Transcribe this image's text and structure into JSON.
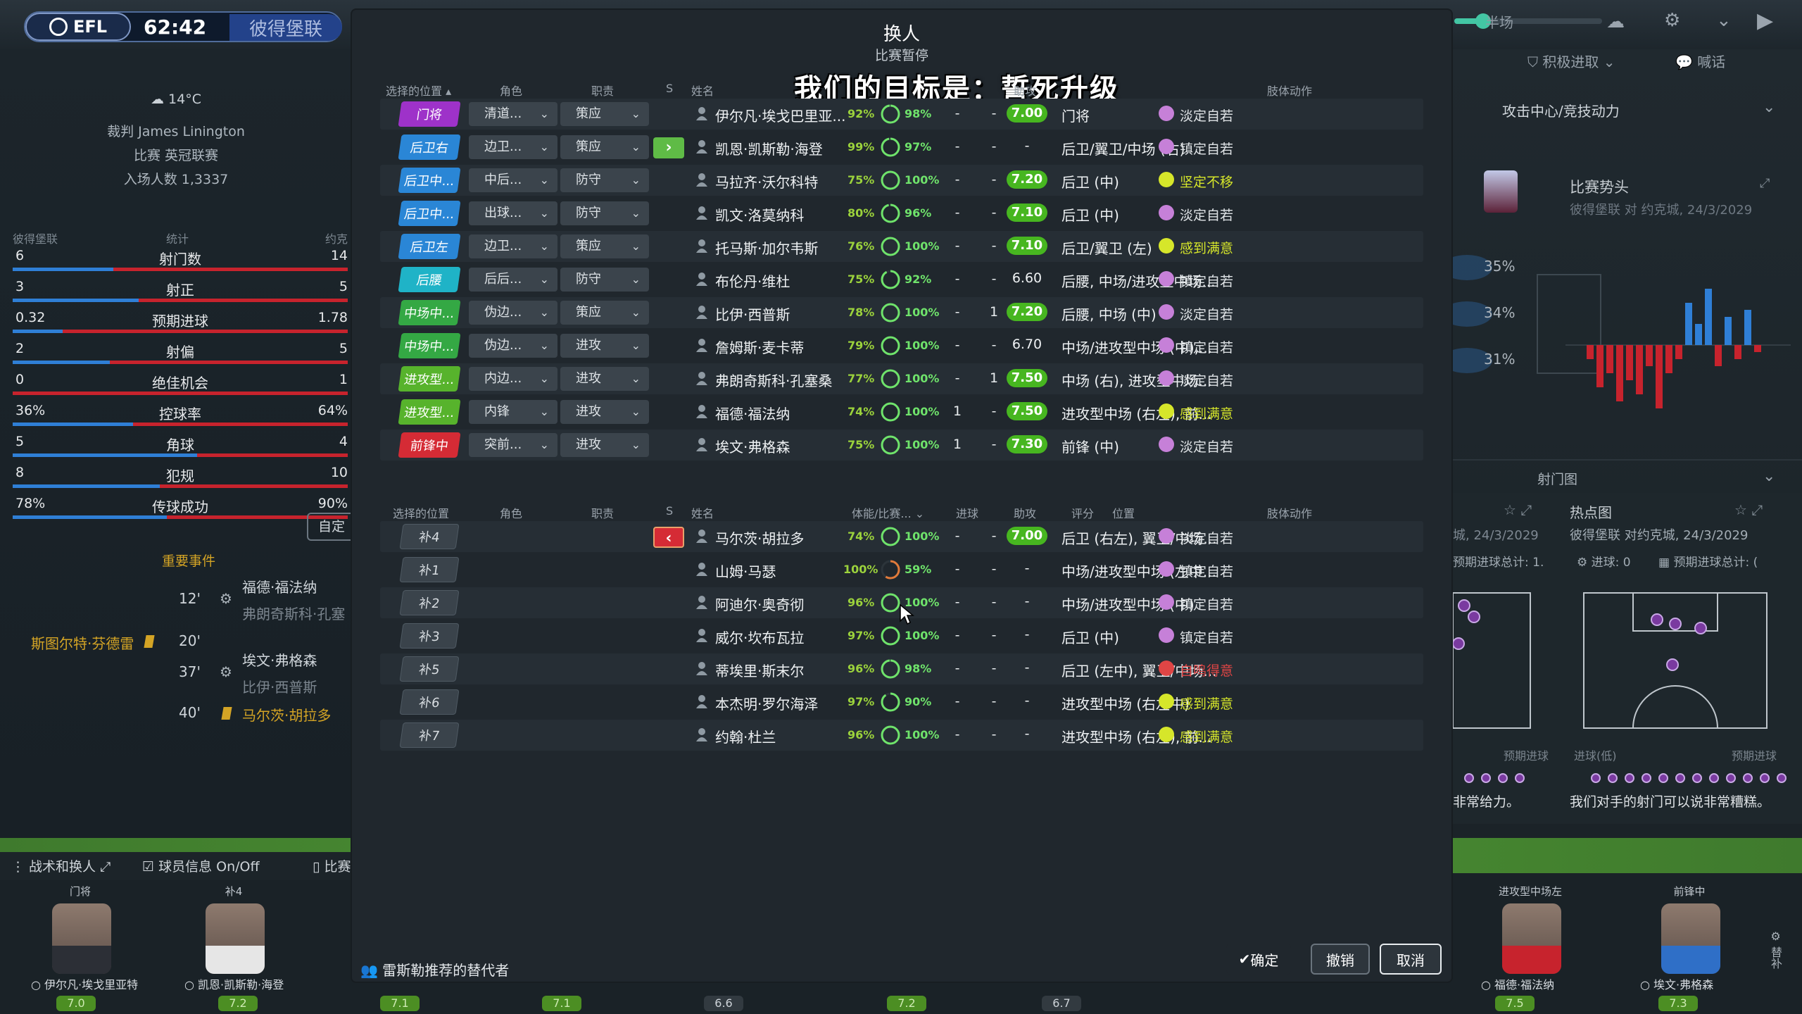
{
  "top": {
    "competition_logo": "EFL",
    "clock": "62:42",
    "team": "彼得堡联",
    "speed_label": "半场"
  },
  "match_info": {
    "weather": "14°C",
    "referee": "裁判 James Linington",
    "competition": "比赛 英冠联赛",
    "attendance": "入场人数 1,3337"
  },
  "stats": {
    "home": "彼得堡联",
    "header": "统计",
    "away": "约克",
    "rows": [
      {
        "label": "射门数",
        "home": "6",
        "away": "14",
        "home_share": 0.3
      },
      {
        "label": "射正",
        "home": "3",
        "away": "5",
        "home_share": 0.375
      },
      {
        "label": "预期进球",
        "home": "0.32",
        "away": "1.78",
        "home_share": 0.15
      },
      {
        "label": "射偏",
        "home": "2",
        "away": "5",
        "home_share": 0.29
      },
      {
        "label": "绝佳机会",
        "home": "0",
        "away": "1",
        "home_share": 0.0
      },
      {
        "label": "控球率",
        "home": "36%",
        "away": "64%",
        "home_share": 0.36
      },
      {
        "label": "角球",
        "home": "5",
        "away": "4",
        "home_share": 0.55
      },
      {
        "label": "犯规",
        "home": "8",
        "away": "10",
        "home_share": 0.44
      },
      {
        "label": "传球成功",
        "home": "78%",
        "away": "90%",
        "home_share": 0.46
      }
    ],
    "customize_button": "自定"
  },
  "events": {
    "header": "重要事件",
    "items": [
      {
        "minute": "12'",
        "player": "福德·福法纳",
        "sub": "弗朗奇斯科·孔塞",
        "type": "substitution"
      },
      {
        "minute": "20'",
        "player": "斯图尔特·芬德雷",
        "type": "yellow-card-away"
      },
      {
        "minute": "37'",
        "player": "埃文·弗格森",
        "sub": "比伊·西普斯",
        "type": "substitution"
      },
      {
        "minute": "40'",
        "player": "马尔茨·胡拉多",
        "type": "yellow-card"
      }
    ]
  },
  "bottom": {
    "tabs": [
      "战术和换人",
      "球员信息 On/Off",
      "比赛"
    ],
    "cards": [
      {
        "pos": "门将",
        "name": "伊尔凡·埃戈里亚特"
      },
      {
        "pos": "补4",
        "name": "凯恩·凯斯勒·海登"
      },
      {
        "pos": "进攻型中场左",
        "name": "福德·福法纳"
      },
      {
        "pos": "前锋中",
        "name": "埃文·弗格森"
      }
    ],
    "ratings": [
      "7.0",
      "7.2",
      "7.1",
      "7.1",
      "6.6",
      "7.2",
      "6.7",
      "7.5",
      "7.3"
    ]
  },
  "right_panel": {
    "dropdown1": "积极进取",
    "dropdown2": "喊话",
    "focus": "攻击中心/竞技动力",
    "momentum_title": "比赛势头",
    "momentum_sub": "彼得堡联 对 约克城, 24/3/2029",
    "percents": [
      "35%",
      "34%",
      "31%"
    ],
    "shotmap_title": "射门图",
    "shotmap_date": "城, 24/3/2029",
    "xg_label": "预期进球总计: 1.",
    "heatmap_title": "热点图",
    "heatmap_sub": "彼得堡联 对约克城, 24/3/2029",
    "goals_label": "进球: 0",
    "xg_label2": "预期进球总计: (",
    "legend_left": "预期进球",
    "legend_mid": "进球(低)",
    "legend_right": "预期进球",
    "caption_left": "非常给力。",
    "caption_right": "我们对手的射门可以说非常糟糕。"
  },
  "dialog": {
    "title": "换人",
    "subtitle": "比赛暂停",
    "overlay": "我们的目标是：誓死升级",
    "headers": {
      "position": "选择的位置",
      "role": "角色",
      "duty": "职责",
      "s": "S",
      "name": "姓名",
      "assist": "助攻",
      "behaviour": "肢体动作"
    },
    "headers2": {
      "position": "选择的位置",
      "role": "角色",
      "duty": "职责",
      "s": "S",
      "name": "姓名",
      "condition": "体能/比赛...",
      "goals": "进球",
      "assists": "助攻",
      "rating": "评分",
      "pos": "位置",
      "behaviour": "肢体动作"
    },
    "starters": [
      {
        "pos": "门将",
        "color": "#9e32c9",
        "role": "清道...",
        "duty": "策应",
        "swap": "",
        "name": "伊尔凡·埃戈巴里亚...",
        "fit": "92%",
        "sharp": "98%",
        "sharpness": 0.98,
        "goals": "-",
        "assists": "-",
        "rating": "7.00",
        "positions": "门将",
        "behaviour": "淡定自若",
        "mood": "neutral"
      },
      {
        "pos": "后卫右",
        "color": "#2a86d6",
        "role": "边卫...",
        "duty": "策应",
        "swap": "in",
        "name": "凯恩·凯斯勒·海登",
        "fit": "99%",
        "sharp": "97%",
        "sharpness": 0.97,
        "goals": "-",
        "assists": "-",
        "rating": "-",
        "positions": "后卫/翼卫/中场 (右)",
        "behaviour": "镇定自若",
        "mood": "neutral"
      },
      {
        "pos": "后卫中...",
        "color": "#2a86d6",
        "role": "中后...",
        "duty": "防守",
        "swap": "",
        "name": "马拉齐·沃尔科特",
        "fit": "75%",
        "sharp": "100%",
        "sharpness": 1.0,
        "goals": "-",
        "assists": "-",
        "rating": "7.20",
        "positions": "后卫 (中)",
        "behaviour": "坚定不移",
        "mood": "happy"
      },
      {
        "pos": "后卫中...",
        "color": "#2a86d6",
        "role": "出球...",
        "duty": "防守",
        "swap": "",
        "name": "凯文·洛莫纳科",
        "fit": "80%",
        "sharp": "96%",
        "sharpness": 0.96,
        "goals": "-",
        "assists": "-",
        "rating": "7.10",
        "positions": "后卫 (中)",
        "behaviour": "淡定自若",
        "mood": "neutral"
      },
      {
        "pos": "后卫左",
        "color": "#2a86d6",
        "role": "边卫...",
        "duty": "策应",
        "swap": "",
        "name": "托马斯·加尔韦斯",
        "fit": "76%",
        "sharp": "100%",
        "sharpness": 1.0,
        "goals": "-",
        "assists": "-",
        "rating": "7.10",
        "positions": "后卫/翼卫 (左)",
        "behaviour": "感到满意",
        "mood": "happy"
      },
      {
        "pos": "后腰",
        "color": "#1fb3c7",
        "role": "后后...",
        "duty": "防守",
        "swap": "",
        "name": "布伦丹·维杜",
        "fit": "75%",
        "sharp": "92%",
        "sharpness": 0.92,
        "goals": "-",
        "assists": "-",
        "rating": "6.60",
        "positions": "后腰, 中场/进攻型中场...",
        "behaviour": "镇定自若",
        "mood": "neutral"
      },
      {
        "pos": "中场中...",
        "color": "#34a844",
        "role": "伪边...",
        "duty": "策应",
        "swap": "",
        "name": "比伊·西普斯",
        "fit": "78%",
        "sharp": "100%",
        "sharpness": 1.0,
        "goals": "-",
        "assists": "1",
        "rating": "7.20",
        "positions": "后腰, 中场 (中)",
        "behaviour": "淡定自若",
        "mood": "neutral"
      },
      {
        "pos": "中场中...",
        "color": "#34a844",
        "role": "伪边...",
        "duty": "进攻",
        "swap": "",
        "name": "詹姆斯·麦卡蒂",
        "fit": "79%",
        "sharp": "100%",
        "sharpness": 1.0,
        "goals": "-",
        "assists": "-",
        "rating": "6.70",
        "positions": "中场/进攻型中场 (中),...",
        "behaviour": "镇定自若",
        "mood": "neutral"
      },
      {
        "pos": "进攻型...",
        "color": "#57b32c",
        "role": "内边...",
        "duty": "进攻",
        "swap": "",
        "name": "弗朗奇斯科·孔塞桑",
        "fit": "77%",
        "sharp": "100%",
        "sharpness": 1.0,
        "goals": "-",
        "assists": "1",
        "rating": "7.50",
        "positions": "中场 (右), 进攻型中场...",
        "behaviour": "淡定自若",
        "mood": "neutral"
      },
      {
        "pos": "进攻型...",
        "color": "#57b32c",
        "role": "内锋",
        "duty": "进攻",
        "swap": "",
        "name": "福德·福法纳",
        "fit": "74%",
        "sharp": "100%",
        "sharpness": 1.0,
        "goals": "1",
        "assists": "-",
        "rating": "7.50",
        "positions": "进攻型中场 (右左), 前...",
        "behaviour": "感到满意",
        "mood": "happy"
      },
      {
        "pos": "前锋中",
        "color": "#d52b35",
        "role": "突前...",
        "duty": "进攻",
        "swap": "",
        "name": "埃文·弗格森",
        "fit": "75%",
        "sharp": "100%",
        "sharpness": 1.0,
        "goals": "1",
        "assists": "-",
        "rating": "7.30",
        "positions": "前锋 (中)",
        "behaviour": "淡定自若",
        "mood": "neutral"
      }
    ],
    "subs": [
      {
        "pos": "补4",
        "swap": "out",
        "name": "马尔茨·胡拉多",
        "fit": "74%",
        "sharp": "100%",
        "sharpness": 1.0,
        "goals": "-",
        "assists": "-",
        "rating": "7.00",
        "positions": "后卫 (右左), 翼卫/中场...",
        "behaviour": "淡定自若",
        "mood": "neutral"
      },
      {
        "pos": "补1",
        "swap": "",
        "name": "山姆·马瑟",
        "fit": "100%",
        "sharp": "59%",
        "sharpness": 0.59,
        "goals": "-",
        "assists": "-",
        "rating": "-",
        "positions": "中场/进攻型中场 (左中...",
        "behaviour": "镇定自若",
        "mood": "neutral"
      },
      {
        "pos": "补2",
        "swap": "",
        "name": "阿迪尔·奥奇彻",
        "fit": "96%",
        "sharp": "100%",
        "sharpness": 1.0,
        "goals": "-",
        "assists": "-",
        "rating": "-",
        "positions": "中场/进攻型中场 (中)",
        "behaviour": "镇定自若",
        "mood": "neutral"
      },
      {
        "pos": "补3",
        "swap": "",
        "name": "威尔·坎布瓦拉",
        "fit": "97%",
        "sharp": "100%",
        "sharpness": 1.0,
        "goals": "-",
        "assists": "-",
        "rating": "-",
        "positions": "后卫 (中)",
        "behaviour": "镇定自若",
        "mood": "neutral"
      },
      {
        "pos": "补5",
        "swap": "",
        "name": "蒂埃里·斯末尔",
        "fit": "96%",
        "sharp": "98%",
        "sharpness": 0.98,
        "goals": "-",
        "assists": "-",
        "rating": "-",
        "positions": "后卫 (左中), 翼卫/中场...",
        "behaviour": "自鸣得意",
        "mood": "smug"
      },
      {
        "pos": "补6",
        "swap": "",
        "name": "本杰明·罗尔海泽",
        "fit": "97%",
        "sharp": "90%",
        "sharpness": 0.9,
        "goals": "-",
        "assists": "-",
        "rating": "-",
        "positions": "进攻型中场 (右左中)",
        "behaviour": "感到满意",
        "mood": "happy"
      },
      {
        "pos": "补7",
        "swap": "",
        "name": "约翰·杜兰",
        "fit": "96%",
        "sharp": "100%",
        "sharpness": 1.0,
        "goals": "-",
        "assists": "-",
        "rating": "-",
        "positions": "进攻型中场 (右左), 前...",
        "behaviour": "感到满意",
        "mood": "happy"
      }
    ],
    "recommend": "雷斯勒推荐的替代者",
    "confirm": "确定",
    "undo": "撤销",
    "cancel": "取消"
  },
  "colors": {
    "accent": "#47b620",
    "sub_in": "#5fbb46",
    "sub_out": "#d52b35",
    "happy": "#d6e62a",
    "neutral": "#c680d8",
    "smug": "#e04545"
  }
}
